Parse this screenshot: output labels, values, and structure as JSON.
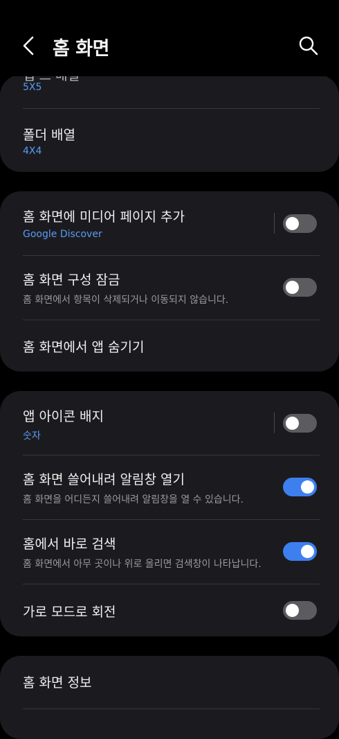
{
  "header": {
    "title": "홈 화면"
  },
  "card1": {
    "partial_title": "앱 스 배열",
    "partial_value": "5X5",
    "folder_grid_title": "폴더 배열",
    "folder_grid_value": "4X4"
  },
  "card2": {
    "media_page_title": "홈 화면에 미디어 페이지 추가",
    "media_page_sub": "Google Discover",
    "media_page_on": false,
    "lock_layout_title": "홈 화면 구성 잠금",
    "lock_layout_sub": "홈 화면에서 항목이 삭제되거나 이동되지 않습니다.",
    "lock_layout_on": false,
    "hide_apps_title": "홈 화면에서 앱 숨기기"
  },
  "card3": {
    "badges_title": "앱 아이콘 배지",
    "badges_sub": "숫자",
    "badges_on": false,
    "swipe_down_title": "홈 화면 쓸어내려 알림창 열기",
    "swipe_down_sub": "홈 화면을 어디든지 쓸어내려 알림창을 열 수 있습니다.",
    "swipe_down_on": true,
    "search_title": "홈에서 바로 검색",
    "search_sub": "홈 화면에서 아무 곳이나 위로 올리면 검색창이 나타납니다.",
    "search_on": true,
    "rotate_title": "가로 모드로 회전",
    "rotate_on": false
  },
  "card4": {
    "about_title": "홈 화면 정보"
  },
  "colors": {
    "background": "#000000",
    "card": "#1b1b1f",
    "accent_blue": "#5a9bf5",
    "switch_on": "#3e7ff0",
    "switch_off": "#5c5c60"
  }
}
